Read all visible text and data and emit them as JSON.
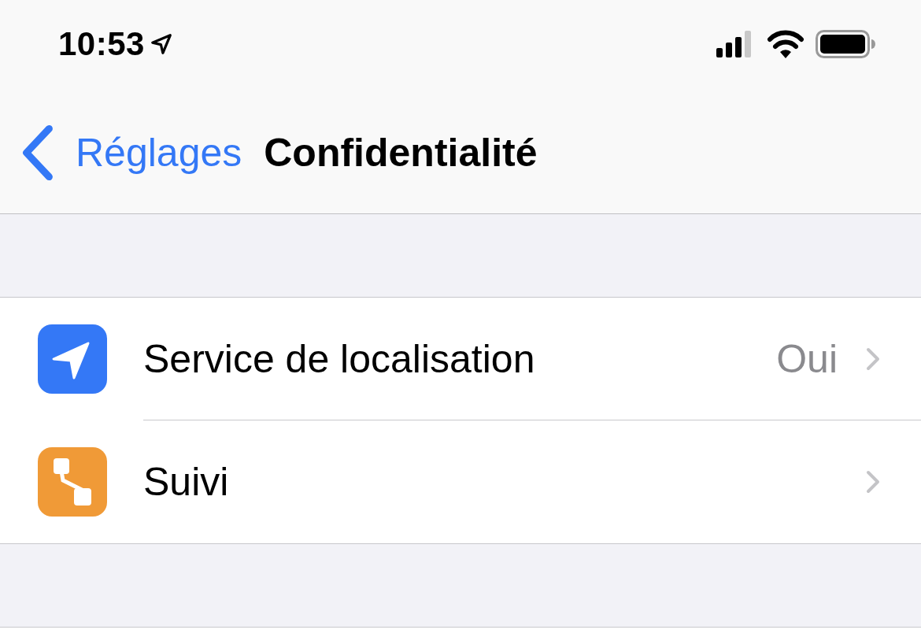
{
  "status_bar": {
    "time": "10:53",
    "location_active": true
  },
  "nav_bar": {
    "back": "Réglages",
    "title": "Confidentialité"
  },
  "rows": [
    {
      "kind": "location",
      "label": "Service de localisation",
      "value": "Oui"
    },
    {
      "kind": "tracking",
      "label": "Suivi"
    }
  ]
}
